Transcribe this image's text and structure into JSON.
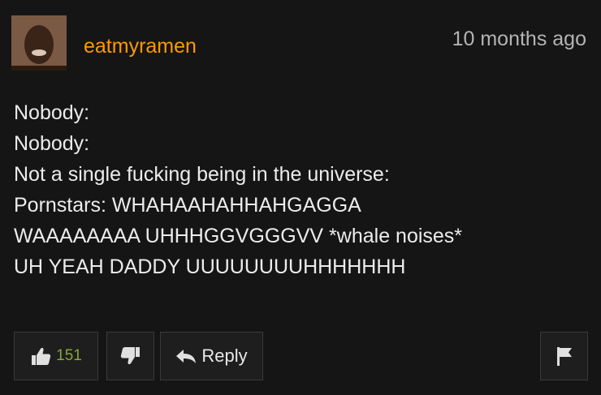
{
  "comment": {
    "username": "eatmyramen",
    "timestamp": "10 months ago",
    "lines": [
      "Nobody:",
      "Nobody:",
      "Not a single fucking being in the universe:",
      "Pornstars: WHAHAAHAHHAHGAGGA",
      "WAAAAAAAA UHHHGGVGGGVV *whale noises*",
      "UH YEAH DADDY UUUUUUUUHHHHHHH"
    ]
  },
  "actions": {
    "like_count": "151",
    "reply_label": "Reply"
  },
  "colors": {
    "background": "#151515",
    "username": "#ff9900",
    "like_count": "#8aa53a",
    "text": "#ececec"
  },
  "icons": [
    "avatar",
    "thumbs-up-icon",
    "thumbs-down-icon",
    "reply-arrow-icon",
    "flag-icon"
  ]
}
